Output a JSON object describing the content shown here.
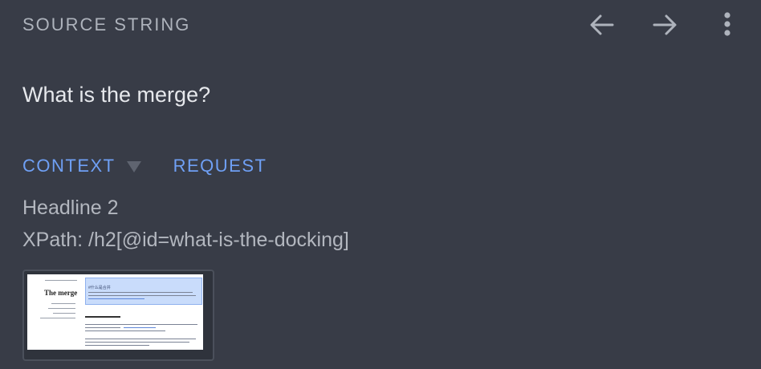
{
  "header": {
    "title": "SOURCE STRING",
    "prev_icon": "arrow-left-icon",
    "next_icon": "arrow-right-icon",
    "more_icon": "more-vertical-icon"
  },
  "source": {
    "text": "What is the merge?"
  },
  "tabs": {
    "context_label": "CONTEXT",
    "request_label": "REQUEST"
  },
  "context": {
    "element_type": "Headline 2",
    "xpath": "XPath: /h2[@id=what-is-the-docking]"
  },
  "screenshot": {
    "page_title": "The merge",
    "highlight_title": "#什么是合并"
  },
  "colors": {
    "background": "#383c47",
    "accent": "#6fa0f5",
    "muted_text": "#aeb3bc",
    "primary_text": "#e6e8ec"
  }
}
